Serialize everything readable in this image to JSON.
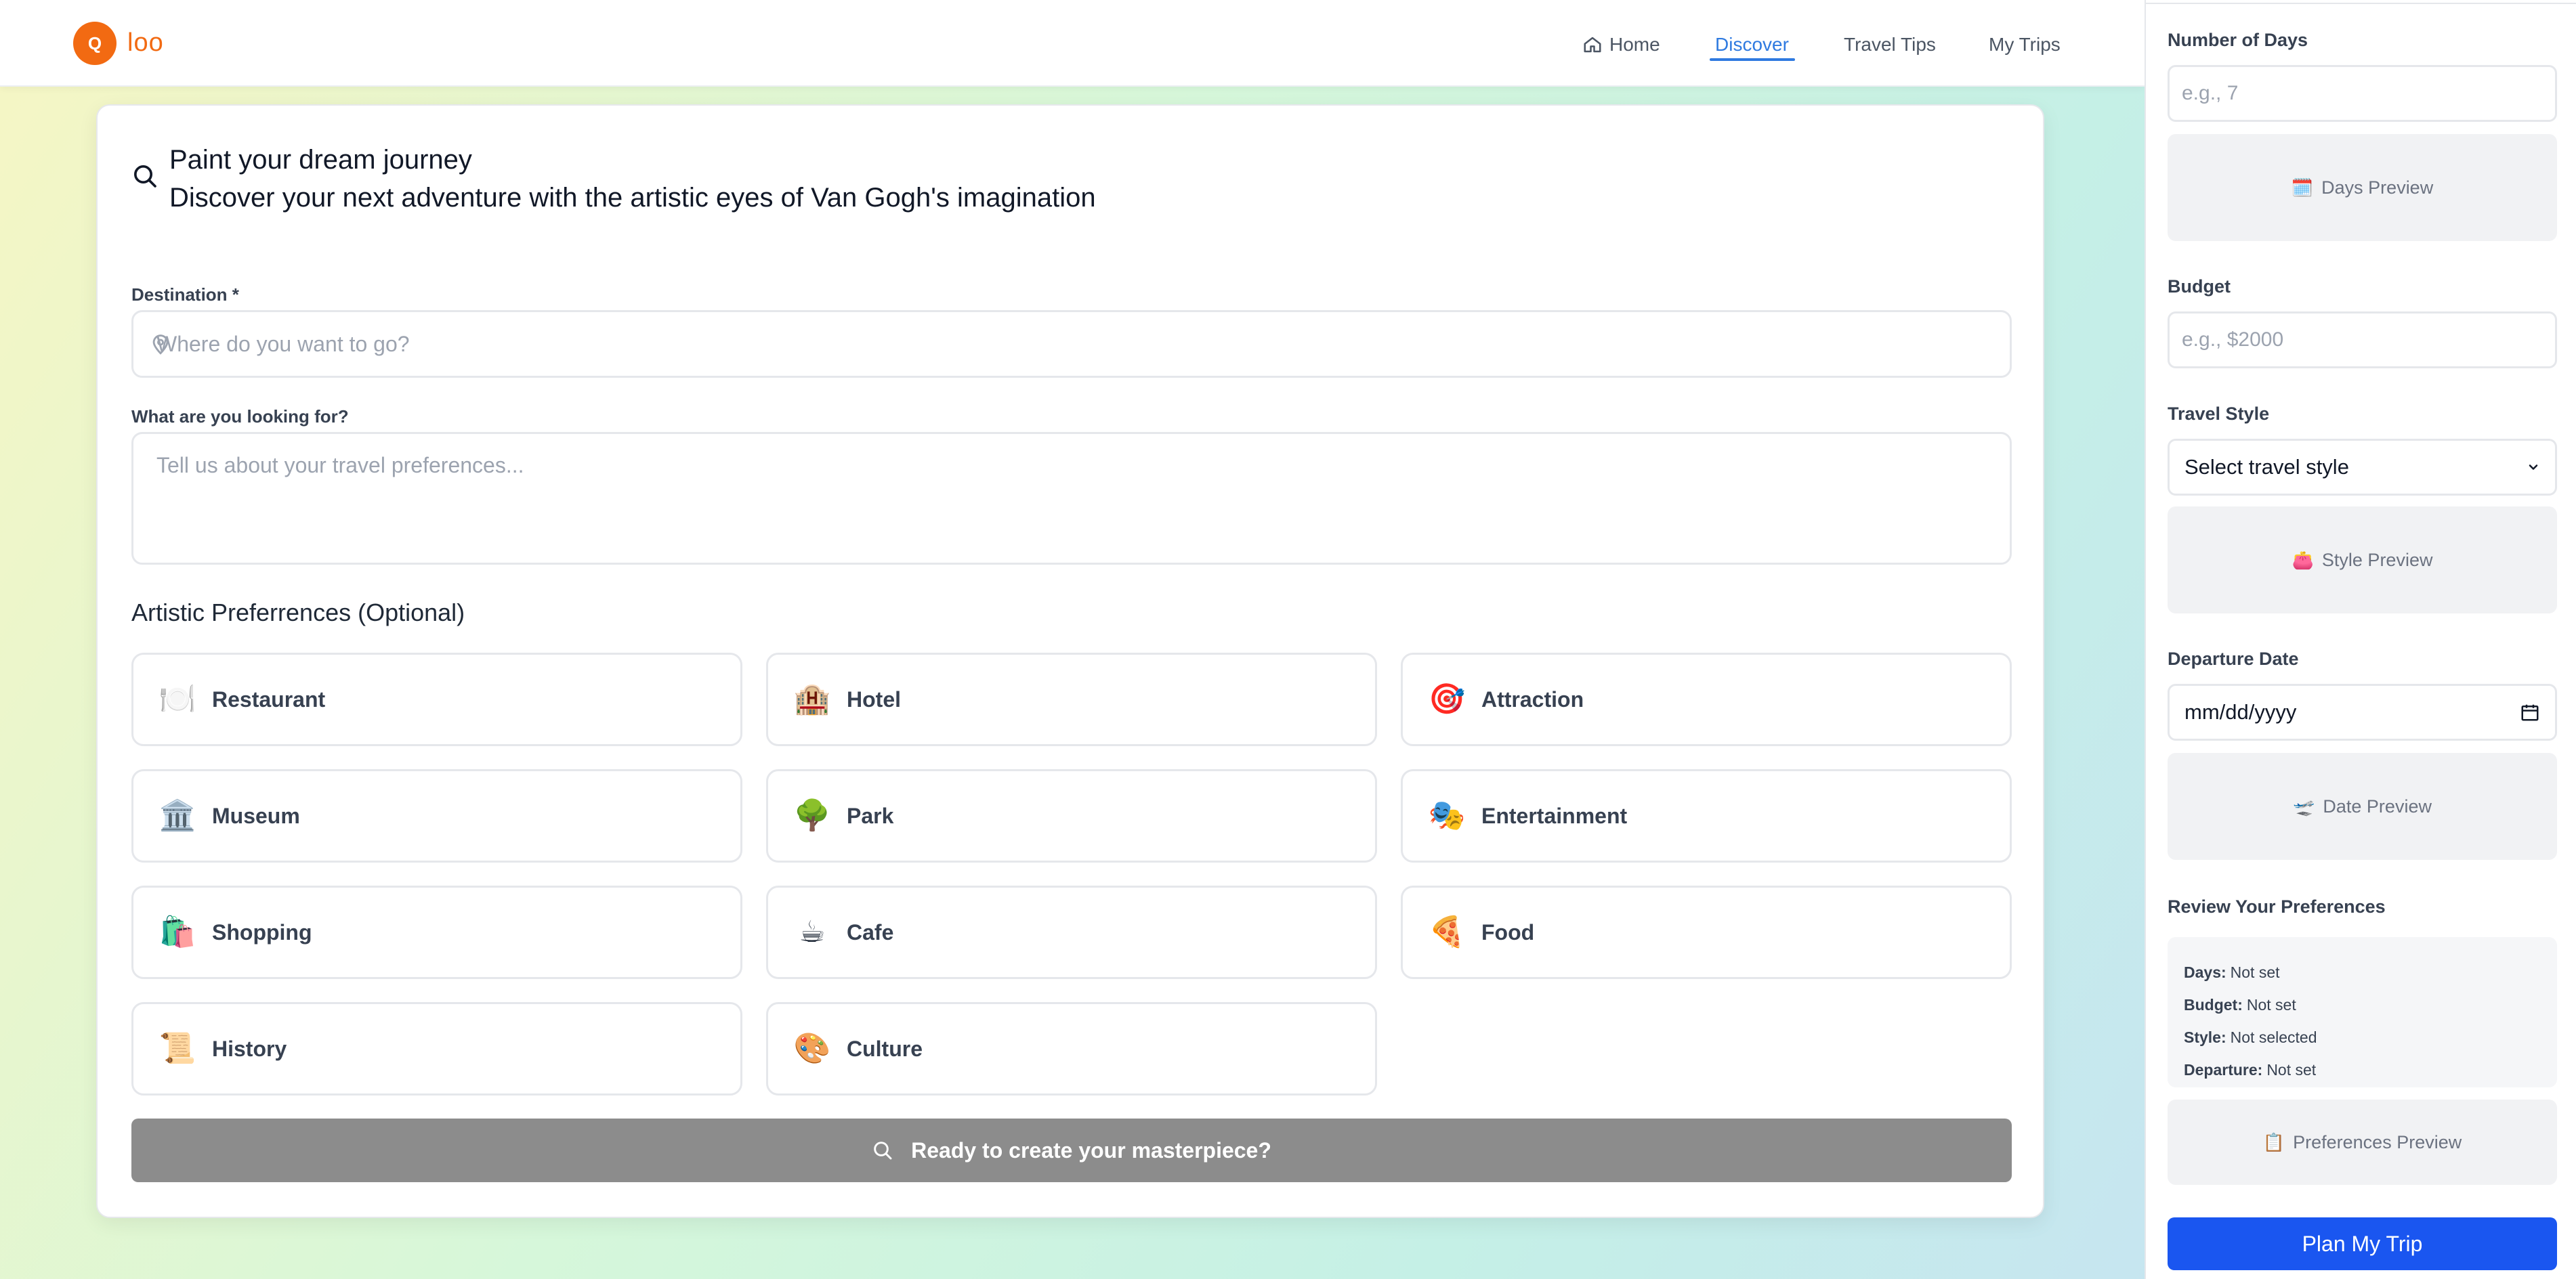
{
  "header": {
    "logo_letter": "Q",
    "logo_text": "loo",
    "nav": [
      {
        "label": "Home",
        "icon": "home-icon"
      },
      {
        "label": "Discover"
      },
      {
        "label": "Travel Tips"
      },
      {
        "label": "My Trips"
      }
    ],
    "active_nav": "Discover",
    "accent_color": "#2f7ae0",
    "brand_color": "#f26a12"
  },
  "main": {
    "title": "Paint your dream journey",
    "subtitle": "Discover your next adventure with the artistic eyes of Van Gogh's imagination",
    "destination": {
      "label": "Destination *",
      "placeholder": "Where do you want to go?",
      "value": ""
    },
    "looking_for": {
      "label": "What are you looking for?",
      "placeholder": "Tell us about your travel preferences...",
      "value": ""
    },
    "preferences_title": "Artistic Preferrences (Optional)",
    "preferences": [
      {
        "label": "Restaurant",
        "emoji": "🍽️"
      },
      {
        "label": "Hotel",
        "emoji": "🏨"
      },
      {
        "label": "Attraction",
        "emoji": "🎯"
      },
      {
        "label": "Museum",
        "emoji": "🏛️"
      },
      {
        "label": "Park",
        "emoji": "🌳"
      },
      {
        "label": "Entertainment",
        "emoji": "🎭"
      },
      {
        "label": "Shopping",
        "emoji": "🛍️"
      },
      {
        "label": "Cafe",
        "emoji": "☕"
      },
      {
        "label": "Food",
        "emoji": "🍕"
      },
      {
        "label": "History",
        "emoji": "📜"
      },
      {
        "label": "Culture",
        "emoji": "🎨"
      }
    ],
    "submit_label": "Ready to create your masterpiece?"
  },
  "sidebar": {
    "days": {
      "label": "Number of Days",
      "placeholder": "e.g., 7",
      "preview": "Days Preview",
      "preview_icon": "🗓️"
    },
    "budget": {
      "label": "Budget",
      "placeholder": "e.g., $2000"
    },
    "style": {
      "label": "Travel Style",
      "selected": "Select travel style",
      "preview": "Style Preview",
      "preview_icon": "👛"
    },
    "departure": {
      "label": "Departure Date",
      "value": "mm/dd/yyyy",
      "preview": "Date Preview",
      "preview_icon": "🛫"
    },
    "review": {
      "title": "Review Your Preferences",
      "days_key": "Days:",
      "days_val": "Not set",
      "budget_key": "Budget:",
      "budget_val": "Not set",
      "style_key": "Style:",
      "style_val": "Not selected",
      "departure_key": "Departure:",
      "departure_val": "Not set"
    },
    "preferences_preview": "Preferences Preview",
    "preferences_preview_icon": "📋",
    "plan_button": "Plan My Trip",
    "plan_button_color": "#1a56f0"
  }
}
